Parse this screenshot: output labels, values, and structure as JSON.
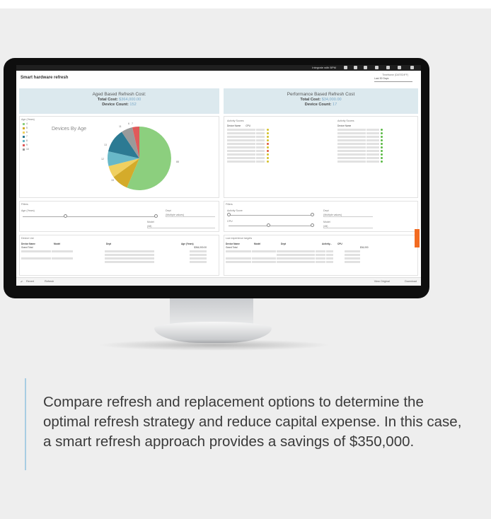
{
  "topbar": {
    "user": "Integrate with BPM"
  },
  "dashboard": {
    "title": "Smart hardware refresh",
    "timeframe_label": "Timeframe (DATEDIFF)",
    "timeframe_value": "Last 30 Days"
  },
  "aged": {
    "title": "Aged Based Refresh Cost:",
    "total_cost_label": "Total Cost:",
    "total_cost_value": "$364,000.00",
    "device_count_label": "Device Count:",
    "device_count_value": "152",
    "legend_title": "Age (Years)",
    "legend": [
      {
        "label": "4",
        "color": "#8ccf7e"
      },
      {
        "label": "5",
        "color": "#d4ab2a"
      },
      {
        "label": "6",
        "color": "#f0d060"
      },
      {
        "label": "7",
        "color": "#2c7a93"
      },
      {
        "label": "8",
        "color": "#68b8c8"
      },
      {
        "label": "9",
        "color": "#e05a5a"
      },
      {
        "label": "10",
        "color": "#9a9a9a"
      }
    ],
    "chart_title": "Devices By Age",
    "pie_labels": [
      "11",
      "6",
      "7",
      "13",
      "12",
      "15",
      "88"
    ]
  },
  "performance": {
    "title": "Performance Based Refresh Cost",
    "total_cost_label": "Total Cost:",
    "total_cost_value": "$34,000.00",
    "device_count_label": "Device Count:",
    "device_count_value": "17",
    "activity_scores_label": "Activity Scores",
    "col_device": "Device Name",
    "col_cpu": "CPU"
  },
  "filters": {
    "label": "Filters",
    "age_years": "Age (Years)",
    "dept": "Dept",
    "dept_value": "(Multiple values)",
    "model": "Model",
    "model_value": "(All)",
    "activity_score": "Activity Score",
    "cpu": "CPU"
  },
  "device_list": {
    "label": "Device List",
    "cols": [
      "Device Name",
      "Model",
      "Dept",
      "Age (Years)"
    ],
    "grand_total": "Grand Total",
    "grand_total_value": "$364,000.00"
  },
  "low_exp": {
    "label": "Low experience targets",
    "cols": [
      "Device Name",
      "Model",
      "Dept",
      "Activity...",
      "CPU"
    ],
    "grand_total": "Grand Total",
    "grand_total_value": "$34,000"
  },
  "bottombar": {
    "revert": "Revert",
    "refresh": "Refresh",
    "view_original": "View Original",
    "download": "Download"
  },
  "caption": "Compare refresh and replacement options to determine the optimal refresh strategy and reduce capital expense. In this case, a smart refresh approach provides a savings of $350,000."
}
